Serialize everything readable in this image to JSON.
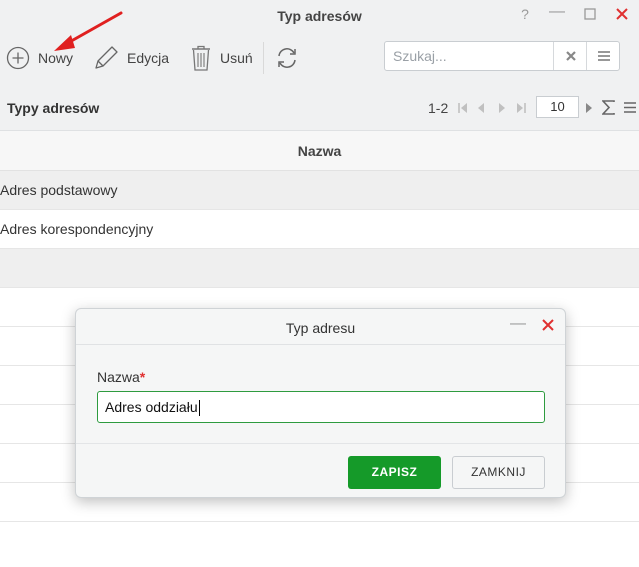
{
  "window": {
    "title": "Typ adresów",
    "help": "?",
    "minimize": "—",
    "maximize": "☐",
    "close": "✕"
  },
  "toolbar": {
    "new_label": "Nowy",
    "edit_label": "Edycja",
    "delete_label": "Usuń",
    "search_placeholder": "Szukaj..."
  },
  "grid": {
    "title": "Typy adresów",
    "range": "1-2",
    "page_size": "10",
    "column_header": "Nazwa",
    "rows": [
      "Adres podstawowy",
      "Adres korespondencyjny"
    ]
  },
  "dialog": {
    "title": "Typ adresu",
    "field_label": "Nazwa",
    "required_mark": "*",
    "field_value": "Adres oddziału",
    "save_label": "ZAPISZ",
    "close_label": "ZAMKNIJ"
  },
  "colors": {
    "accent_green": "#159a29",
    "close_red": "#e03030",
    "annotation_arrow": "#e02020"
  }
}
